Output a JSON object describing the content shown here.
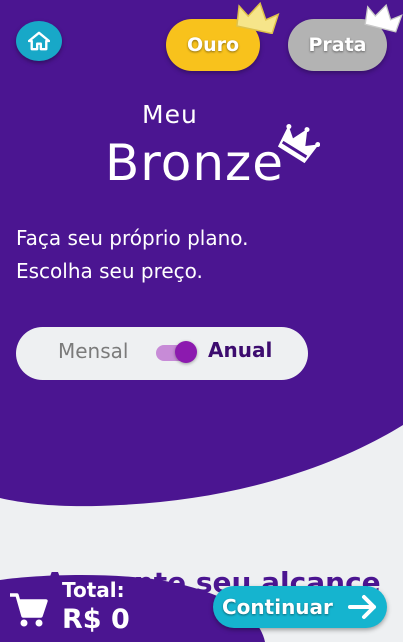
{
  "header": {
    "home_icon": "home-icon",
    "plans": [
      {
        "label": "Ouro",
        "color": "#f8c21c",
        "icon": "crown-icon"
      },
      {
        "label": "Prata",
        "color": "#b3b3b3",
        "icon": "crown-icon"
      }
    ]
  },
  "hero": {
    "title_prefix": "Meu",
    "title_main": "Bronze",
    "subtitle_line1": "Faça seu próprio plano.",
    "subtitle_line2": "Escolha seu preço.",
    "background_color": "#4b1591"
  },
  "billing": {
    "monthly_label": "Mensal",
    "yearly_label": "Anual",
    "selected": "Anual",
    "accent_color": "#8c1aaf"
  },
  "content": {
    "partial_heading": "Aumente seu alcance de número de"
  },
  "footer": {
    "cart_icon": "cart-icon",
    "total_label": "Total:",
    "total_value": "R$ 0",
    "continue_label": "Continuar",
    "continue_icon": "arrow-right-icon",
    "button_color": "#15b4cf"
  }
}
